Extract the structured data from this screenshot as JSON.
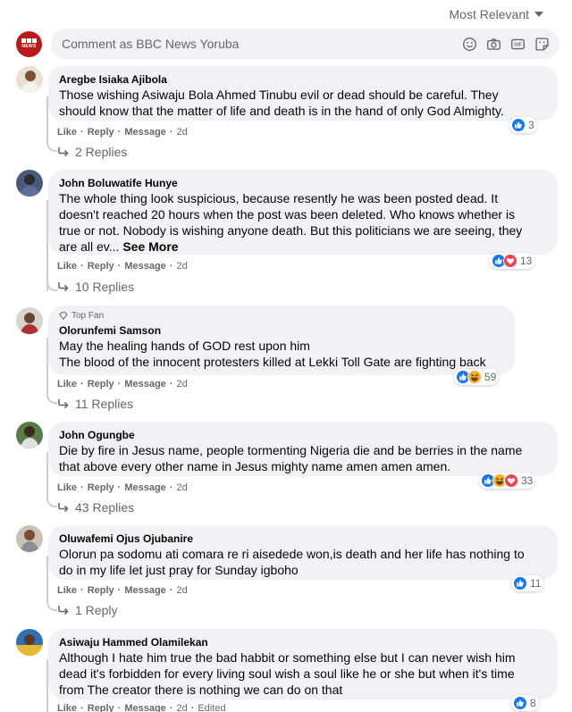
{
  "sort": {
    "label": "Most Relevant"
  },
  "composer": {
    "placeholder": "Comment as BBC News Yoruba",
    "avatar_text": "NEWS"
  },
  "actions": {
    "like": "Like",
    "reply": "Reply",
    "message": "Message",
    "sep": "·"
  },
  "colors": {
    "like_blue": "#1877f2",
    "love_red": "#f33e58",
    "haha_yellow": "#f7b125",
    "bubble": "#f0f2f5",
    "meta": "#65676b"
  },
  "comments": [
    {
      "name": "Aregbe Isiaka Ajibola",
      "top_fan": false,
      "lines": [
        "Those wishing Asiwaju Bola Ahmed Tinubu evil or dead should be careful. They",
        "should know that the matter of life and death is in the hand of only God Almighty."
      ],
      "see_more": "",
      "time": "2d",
      "reaction_count": "3",
      "reaction_icons": [
        "like-icon"
      ],
      "replies": "2 Replies"
    },
    {
      "name": "John Boluwatife Hunye",
      "top_fan": false,
      "lines": [
        "The whole thing look suspicious, because resently he was been posted dead. It",
        "doesn't reached 20 hours when the post was been deleted. Who knows whether is",
        "true or not. Nobody is wishing anyone death. But this politicians we are seeing, they",
        "are all ev... "
      ],
      "see_more": "See More",
      "time": "2d",
      "reaction_count": "13",
      "reaction_icons": [
        "like-icon",
        "love-icon"
      ],
      "replies": "10 Replies"
    },
    {
      "name": "Olorunfemi Samson",
      "top_fan": true,
      "top_fan_label": "Top Fan",
      "lines": [
        "May the healing hands of GOD rest upon him",
        "The blood of the innocent protesters killed at Lekki Toll Gate are fighting back"
      ],
      "see_more": "",
      "time": "2d",
      "reaction_count": "59",
      "reaction_icons": [
        "like-icon",
        "haha-icon"
      ],
      "replies": "11 Replies"
    },
    {
      "name": "John Ogungbe",
      "top_fan": false,
      "lines": [
        "Die by fire in Jesus name, people tormenting Nigeria die and be berries in the name",
        "that above every other name in Jesus mighty name amen amen amen."
      ],
      "see_more": "",
      "time": "2d",
      "reaction_count": "33",
      "reaction_icons": [
        "like-icon",
        "haha-icon",
        "love-icon"
      ],
      "replies": "43 Replies"
    },
    {
      "name": "Oluwafemi Ojus Ojubanire",
      "top_fan": false,
      "lines": [
        "Olorun pa sodomu ati comara re ri aisedede won,is death and her life has nothing to",
        "do in my life let just pray for Sunday igboho"
      ],
      "see_more": "",
      "time": "2d",
      "reaction_count": "11",
      "reaction_icons": [
        "like-icon"
      ],
      "replies": "1 Reply"
    },
    {
      "name": "Asiwaju Hammed Olamilekan",
      "top_fan": false,
      "lines": [
        "Although I hate him true the bad habbit or something else but I can never wish him",
        "dead it's forbidden for every living soul wish a soul like he or she but when it's time",
        "from The creator there is nothing we can do on that"
      ],
      "see_more": "",
      "time": "2d",
      "edited": "Edited",
      "reaction_count": "8",
      "reaction_icons": [
        "like-icon"
      ],
      "replies": ""
    }
  ]
}
